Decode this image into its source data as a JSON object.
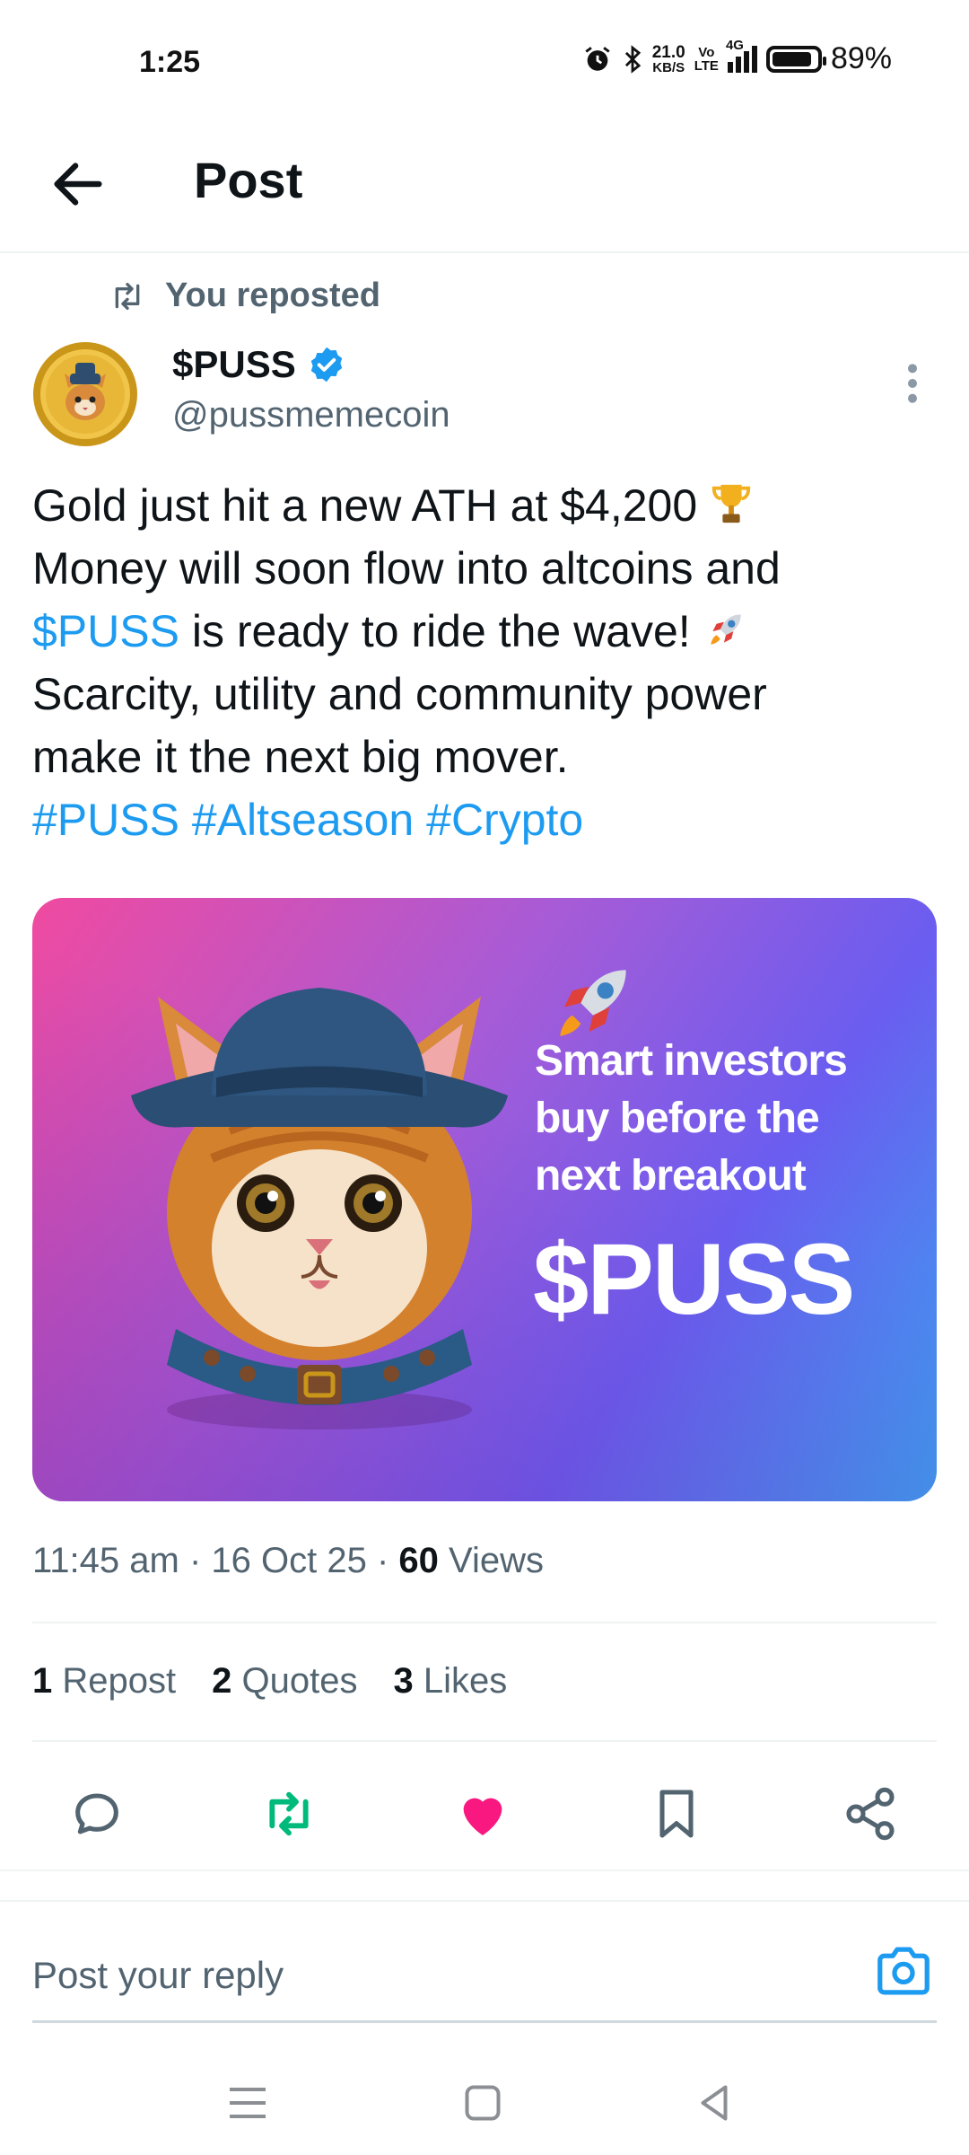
{
  "status_bar": {
    "time": "1:25",
    "net_speed_value": "21.0",
    "net_speed_unit": "KB/S",
    "volte_top": "Vo",
    "volte_bottom": "LTE",
    "network": "4G",
    "battery_percent": "89%",
    "battery_level": 0.89
  },
  "header": {
    "title": "Post",
    "back_icon": "arrow-left-icon"
  },
  "repost_banner": {
    "icon": "repost-icon",
    "text": "You reposted"
  },
  "author": {
    "name": "$PUSS",
    "handle": "@pussmemecoin",
    "verified_icon": "verified-badge-icon"
  },
  "tweet": {
    "line1": "Gold just hit a new ATH at $4,200",
    "line2": "Money will soon flow into altcoins  and",
    "line3_link": "$PUSS",
    "line3_rest": " is ready to ride the wave!",
    "line4": "Scarcity, utility and community power",
    "line5": "make it the next big mover.",
    "hashtags": "#PUSS #Altseason #Crypto"
  },
  "media": {
    "promo_line1": "Smart investors",
    "promo_line2": "buy before the",
    "promo_line3": "next breakout",
    "promo_ticker": "$PUSS",
    "colors": {
      "start": "#f04aa0",
      "mid": "#6a5df0",
      "end": "#3b9ff0"
    }
  },
  "meta": {
    "time": "11:45 am",
    "date": "16 Oct 25",
    "views_count": "60",
    "views_label": "Views",
    "sep": "·"
  },
  "stats": {
    "reposts_count": "1",
    "reposts_label": "Repost",
    "quotes_count": "2",
    "quotes_label": "Quotes",
    "likes_count": "3",
    "likes_label": "Likes"
  },
  "actions": [
    {
      "name": "reply",
      "icon": "reply-icon"
    },
    {
      "name": "repost",
      "icon": "repost-icon",
      "color": "#00ba7c"
    },
    {
      "name": "like",
      "icon": "heart-icon",
      "color": "#f91880"
    },
    {
      "name": "bookmark",
      "icon": "bookmark-icon"
    },
    {
      "name": "share",
      "icon": "share-icon"
    }
  ],
  "reply": {
    "placeholder": "Post your reply",
    "camera_icon": "camera-icon",
    "accent": "#1d9bf0"
  }
}
